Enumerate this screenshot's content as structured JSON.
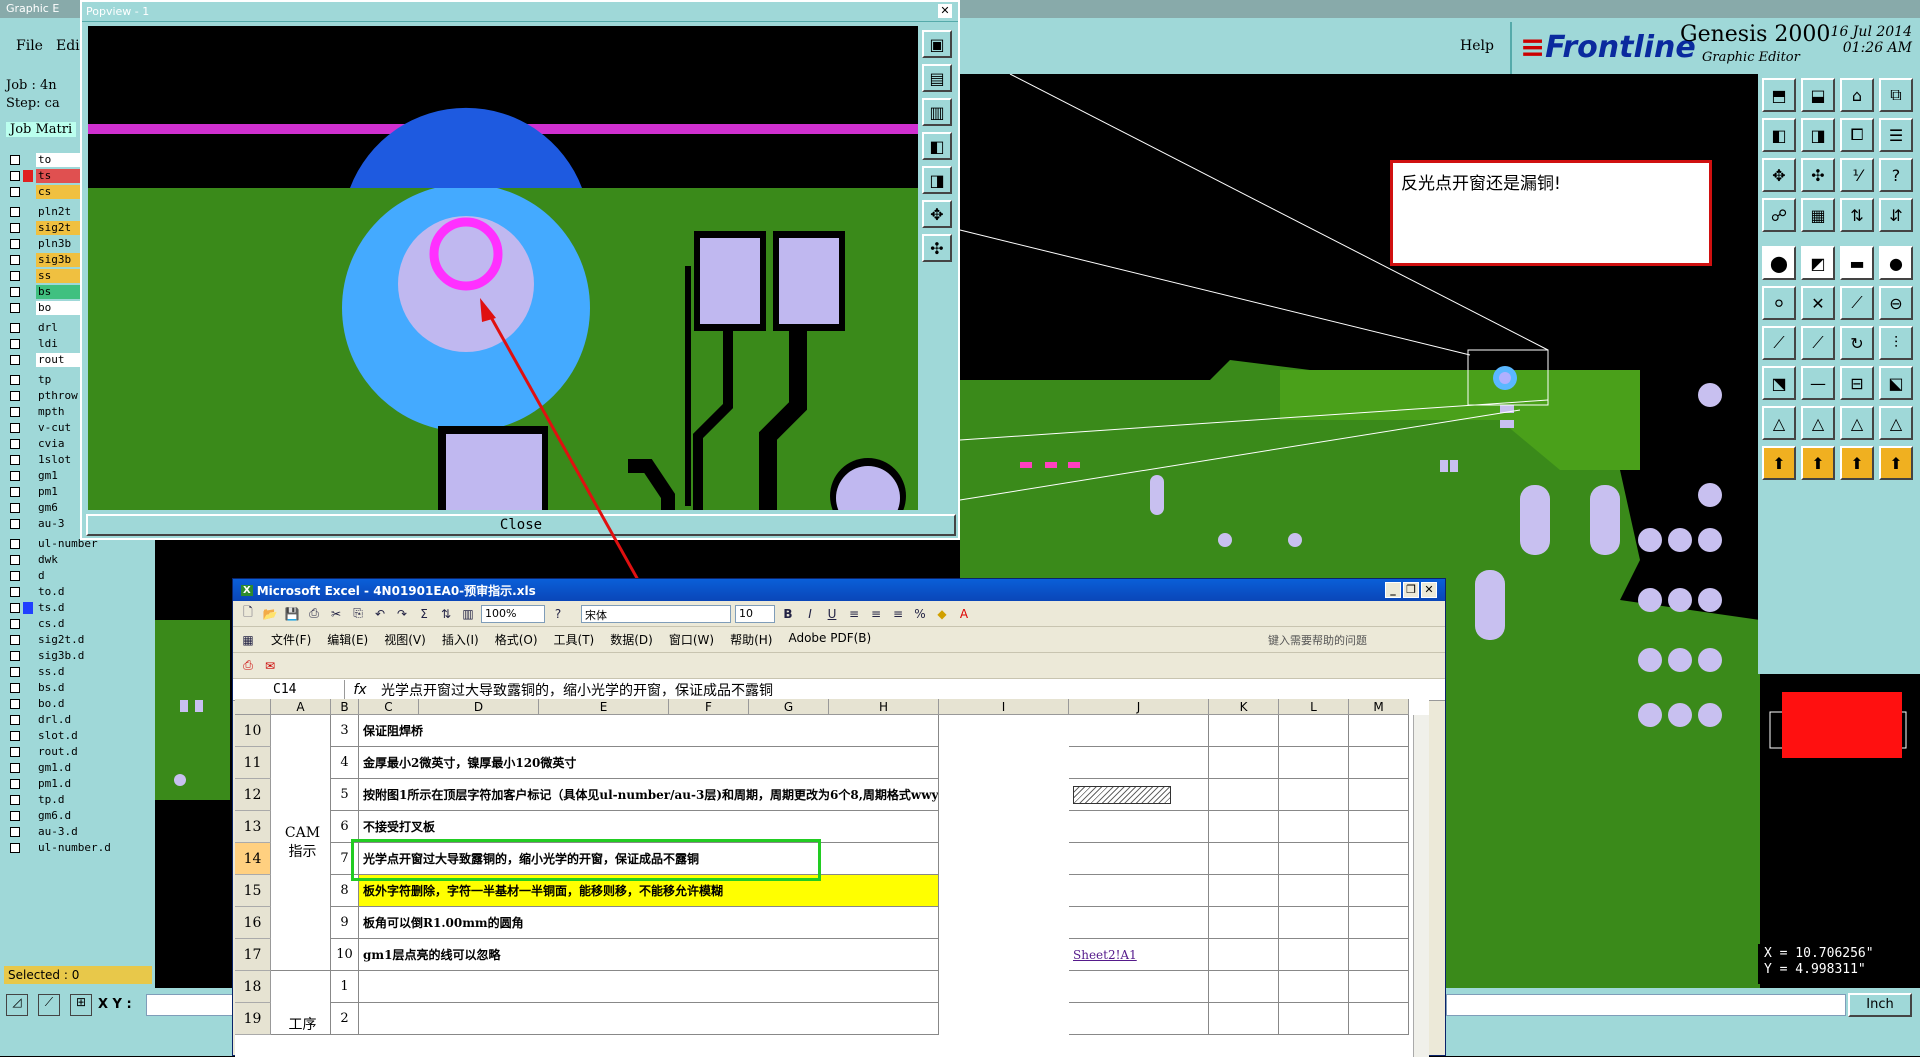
{
  "genesis": {
    "title": "Graphic E",
    "menu": {
      "file": "File",
      "edit": "Edi",
      "help": "Help"
    },
    "brand": {
      "logo": "Frontline",
      "product": "Genesis 2000",
      "subtitle": "Graphic Editor",
      "date": "16 Jul 2014",
      "time": "01:26 AM"
    },
    "job": "Job : 4n",
    "step": "Step: ca",
    "job_matrix": "Job Matri",
    "layers": [
      {
        "name": "to",
        "color": "#ffffff"
      },
      {
        "name": "ts",
        "color": "#e05050"
      },
      {
        "name": "cs",
        "color": "#f0c040"
      },
      {
        "name": "pln2t",
        "color": "#9fd8d8"
      },
      {
        "name": "sig2t",
        "color": "#f0c040"
      },
      {
        "name": "pln3b",
        "color": "#9fd8d8"
      },
      {
        "name": "sig3b",
        "color": "#f0c040"
      },
      {
        "name": "ss",
        "color": "#f0c040"
      },
      {
        "name": "bs",
        "color": "#40c080"
      },
      {
        "name": "bo",
        "color": "#ffffff"
      },
      {
        "name": "drl",
        "color": "#9fd8d8"
      },
      {
        "name": "ldi",
        "color": "#9fd8d8"
      },
      {
        "name": "rout",
        "color": "#ffffff"
      },
      {
        "name": "tp",
        "color": "#9fd8d8"
      },
      {
        "name": "pthrow",
        "color": "#9fd8d8"
      },
      {
        "name": "mpth",
        "color": "#9fd8d8"
      },
      {
        "name": "v-cut",
        "color": "#9fd8d8"
      },
      {
        "name": "cvia",
        "color": "#9fd8d8"
      },
      {
        "name": "1slot",
        "color": "#9fd8d8"
      },
      {
        "name": "gm1",
        "color": "#9fd8d8"
      },
      {
        "name": "pm1",
        "color": "#9fd8d8"
      },
      {
        "name": "gm6",
        "color": "#9fd8d8"
      },
      {
        "name": "au-3",
        "color": "#9fd8d8"
      },
      {
        "name": "ul-number",
        "color": "#9fd8d8"
      },
      {
        "name": "dwk",
        "color": "#9fd8d8"
      },
      {
        "name": "d",
        "color": "#9fd8d8"
      },
      {
        "name": "to.d",
        "color": "#9fd8d8"
      },
      {
        "name": "ts.d",
        "color": "#9fd8d8"
      },
      {
        "name": "cs.d",
        "color": "#9fd8d8"
      },
      {
        "name": "sig2t.d",
        "color": "#9fd8d8"
      },
      {
        "name": "sig3b.d",
        "color": "#9fd8d8"
      },
      {
        "name": "ss.d",
        "color": "#9fd8d8"
      },
      {
        "name": "bs.d",
        "color": "#9fd8d8"
      },
      {
        "name": "bo.d",
        "color": "#9fd8d8"
      },
      {
        "name": "drl.d",
        "color": "#9fd8d8"
      },
      {
        "name": "slot.d",
        "color": "#9fd8d8"
      },
      {
        "name": "rout.d",
        "color": "#9fd8d8"
      },
      {
        "name": "gm1.d",
        "color": "#9fd8d8"
      },
      {
        "name": "pm1.d",
        "color": "#9fd8d8"
      },
      {
        "name": "tp.d",
        "color": "#9fd8d8"
      },
      {
        "name": "gm6.d",
        "color": "#9fd8d8"
      },
      {
        "name": "au-3.d",
        "color": "#9fd8d8"
      },
      {
        "name": "ul-number.d",
        "color": "#9fd8d8"
      }
    ],
    "selected": "Selected : 0",
    "xy_label": "X Y :",
    "unit": "Inch",
    "coords": {
      "x": "X = 10.706256\"",
      "y": "Y = 4.998311\""
    },
    "note": "反光点开窗还是漏铜!"
  },
  "popview": {
    "title": "Popview - 1",
    "close": "Close"
  },
  "excel": {
    "title": "Microsoft Excel - 4N01901EA0-预审指示.xls",
    "zoom": "100%",
    "font": "宋体",
    "size": "10",
    "menu": [
      "文件(F)",
      "编辑(E)",
      "视图(V)",
      "插入(I)",
      "格式(O)",
      "工具(T)",
      "数据(D)",
      "窗口(W)",
      "帮助(H)",
      "Adobe PDF(B)"
    ],
    "help_placeholder": "键入需要帮助的问题",
    "namebox": "C14",
    "formula": "光学点开窗过大导致露铜的，缩小光学的开窗，保证成品不露铜",
    "columns": [
      "A",
      "B",
      "C",
      "D",
      "E",
      "F",
      "G",
      "H",
      "I",
      "J",
      "K",
      "L",
      "M"
    ],
    "group_cam": "CAM\n指示",
    "group_proc": "工序",
    "rows": [
      {
        "row": "10",
        "num": "3",
        "text": "保证阻焊桥",
        "j": ""
      },
      {
        "row": "11",
        "num": "4",
        "text": "金厚最小2微英寸，镍厚最小120微英寸",
        "j": ""
      },
      {
        "row": "12",
        "num": "5",
        "text": "按附图1所示在顶层字符加客户标记（具体见ul-number/au-3层)和周期，周期更改为6个8,周期格式wwyyyy",
        "j": ""
      },
      {
        "row": "13",
        "num": "6",
        "text": "不接受打叉板",
        "j": ""
      },
      {
        "row": "14",
        "num": "7",
        "text": "光学点开窗过大导致露铜的，缩小光学的开窗，保证成品不露铜",
        "j": ""
      },
      {
        "row": "15",
        "num": "8",
        "text": "板外字符删除，字符一半基材一半铜面，能移则移，不能移允许模糊",
        "j": ""
      },
      {
        "row": "16",
        "num": "9",
        "text": "板角可以倒R1.00mm的圆角",
        "j": ""
      },
      {
        "row": "17",
        "num": "10",
        "text": "gm1层点亮的线可以忽略",
        "j": "Sheet2!A1"
      },
      {
        "row": "18",
        "num": "1",
        "text": "",
        "j": ""
      },
      {
        "row": "19",
        "num": "2",
        "text": "",
        "j": ""
      }
    ]
  }
}
